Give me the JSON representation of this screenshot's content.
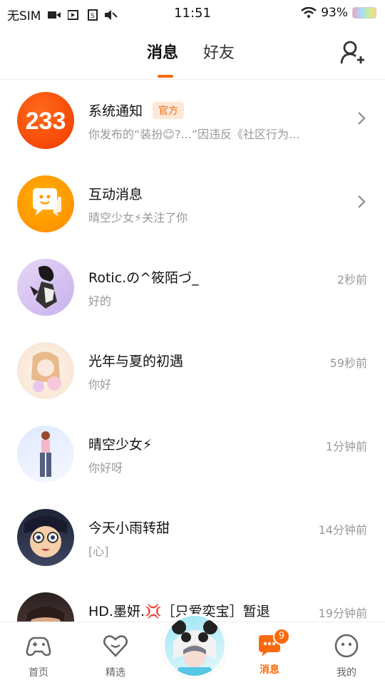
{
  "status_bar": {
    "carrier": "无SIM",
    "time": "11:51",
    "battery": "93%"
  },
  "header": {
    "tabs": [
      {
        "label": "消息",
        "active": true
      },
      {
        "label": "好友",
        "active": false
      }
    ],
    "add_friend_icon": "add-person-icon"
  },
  "messages": [
    {
      "name": "系统通知",
      "badge": "官方",
      "preview": "你发布的“装扮😊?...”因违反《社区行为…",
      "time": "",
      "chevron": true
    },
    {
      "name": "互动消息",
      "preview": "晴空少女⚡关注了你",
      "time": "",
      "chevron": true
    },
    {
      "name": "Rotic.の^筱陌づ_",
      "preview": "好的",
      "time": "2秒前"
    },
    {
      "name": "光年与夏的初遇",
      "preview": "你好",
      "time": "59秒前"
    },
    {
      "name": "晴空少女⚡",
      "preview": "你好呀",
      "time": "1分钟前"
    },
    {
      "name": "今天小雨转甜",
      "preview": "[心]",
      "time": "14分钟前"
    },
    {
      "name": "HD.墨妍.💢［只爱奕宝］暂退",
      "preview": "",
      "time": "19分钟前"
    }
  ],
  "tabbar": {
    "items": [
      {
        "label": "首页",
        "icon": "gamepad-icon"
      },
      {
        "label": "精选",
        "icon": "heart-icon"
      },
      {
        "label": "消息",
        "icon": "message-icon",
        "badge": "9",
        "active": true
      },
      {
        "label": "我的",
        "icon": "smiley-icon"
      }
    ]
  },
  "colors": {
    "accent": "#f96a0e",
    "secondary_text": "#999999"
  }
}
